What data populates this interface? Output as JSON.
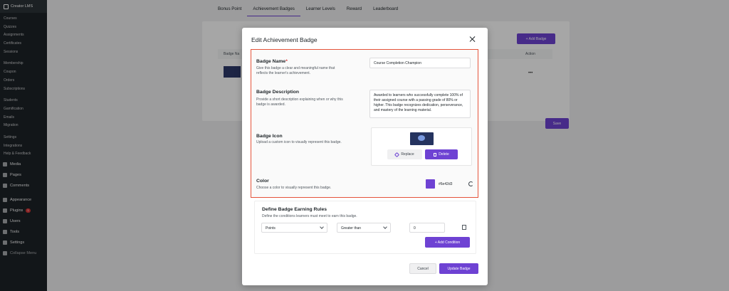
{
  "sidebar": {
    "brand": "Creator LMS",
    "sub_items": [
      "Courses",
      "Quizzes",
      "Assignments",
      "Certificates",
      "Sessions",
      "",
      "Membership",
      "Coupon",
      "Orders",
      "Subscriptions",
      "",
      "Students",
      "Gamification",
      "Emails",
      "Migration",
      "",
      "Settings",
      "Integrations",
      "Help & Feedback"
    ],
    "main_items": [
      {
        "label": "Media",
        "icon": "media-icon"
      },
      {
        "label": "Pages",
        "icon": "pages-icon"
      },
      {
        "label": "Comments",
        "icon": "comments-icon"
      },
      {
        "label": "Appearance",
        "icon": "appearance-icon"
      },
      {
        "label": "Plugins",
        "icon": "plugins-icon",
        "badge": "1"
      },
      {
        "label": "Users",
        "icon": "users-icon"
      },
      {
        "label": "Tools",
        "icon": "tools-icon"
      },
      {
        "label": "Settings",
        "icon": "settings-icon"
      },
      {
        "label": "Collapse Menu",
        "icon": "collapse-icon"
      }
    ]
  },
  "tabs": [
    "Bonus Point",
    "Achievement Badges",
    "Learner Levels",
    "Reward",
    "Leaderboard"
  ],
  "active_tab": "Achievement Badges",
  "background": {
    "add_badge": "+ Add Badge",
    "col_badge": "Badge Na",
    "col_action": "Action",
    "dots": "•••",
    "save": "Save"
  },
  "modal": {
    "title": "Edit Achievement Badge",
    "badge_name": {
      "label": "Badge Name",
      "required": "*",
      "desc": "Give this badge a clear and meaningful name that reflects the learner's achievement.",
      "value": "Course Completion Champion"
    },
    "badge_description": {
      "label": "Badge Description",
      "desc": "Provide a short description explaining when or why this badge is awarded.",
      "value": "Awarded to learners who successfully complete 100% of their assigned course with a passing grade of 80% or higher. This badge recognizes dedication, perseverance, and mastery of the learning material."
    },
    "badge_icon": {
      "label": "Badge Icon",
      "desc": "Upload a custom icon to visually represent this badge.",
      "replace": "Replace",
      "delete": "Delete"
    },
    "color": {
      "label": "Color",
      "desc": "Choose a color to visually represent this badge.",
      "hex": "#6e42d3"
    },
    "rules": {
      "title": "Define Badge Earning Rules",
      "desc": "Define the conditions learners must meet to earn this badge.",
      "type": "Points",
      "operator": "Greater than",
      "value": "0",
      "add_condition": "+ Add Condition"
    },
    "cancel": "Cancel",
    "update": "Update Badge"
  },
  "colors": {
    "accent": "#6e42d3",
    "highlight": "#e4533a",
    "sidebar": "#1d2327"
  }
}
